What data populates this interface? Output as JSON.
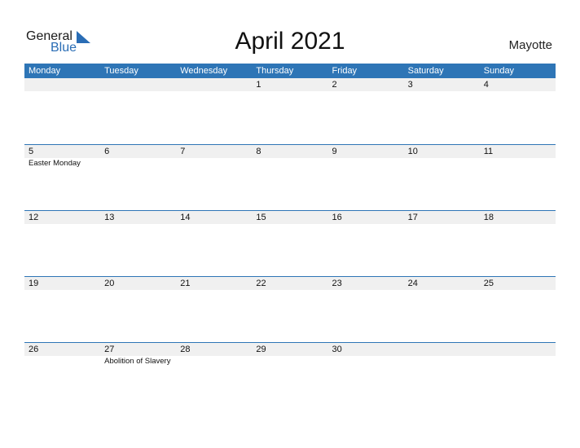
{
  "logo": {
    "line1": "General",
    "line2": "Blue"
  },
  "title": "April 2021",
  "country": "Mayotte",
  "colors": {
    "accent": "#2e75b6",
    "row_bg": "#f0f0f0"
  },
  "weekdays": [
    "Monday",
    "Tuesday",
    "Wednesday",
    "Thursday",
    "Friday",
    "Saturday",
    "Sunday"
  ],
  "weeks": [
    {
      "days": [
        "",
        "",
        "",
        "1",
        "2",
        "3",
        "4"
      ],
      "events": [
        "",
        "",
        "",
        "",
        "",
        "",
        ""
      ]
    },
    {
      "days": [
        "5",
        "6",
        "7",
        "8",
        "9",
        "10",
        "11"
      ],
      "events": [
        "Easter Monday",
        "",
        "",
        "",
        "",
        "",
        ""
      ]
    },
    {
      "days": [
        "12",
        "13",
        "14",
        "15",
        "16",
        "17",
        "18"
      ],
      "events": [
        "",
        "",
        "",
        "",
        "",
        "",
        ""
      ]
    },
    {
      "days": [
        "19",
        "20",
        "21",
        "22",
        "23",
        "24",
        "25"
      ],
      "events": [
        "",
        "",
        "",
        "",
        "",
        "",
        ""
      ]
    },
    {
      "days": [
        "26",
        "27",
        "28",
        "29",
        "30",
        "",
        ""
      ],
      "events": [
        "",
        "Abolition of Slavery",
        "",
        "",
        "",
        "",
        ""
      ]
    }
  ]
}
